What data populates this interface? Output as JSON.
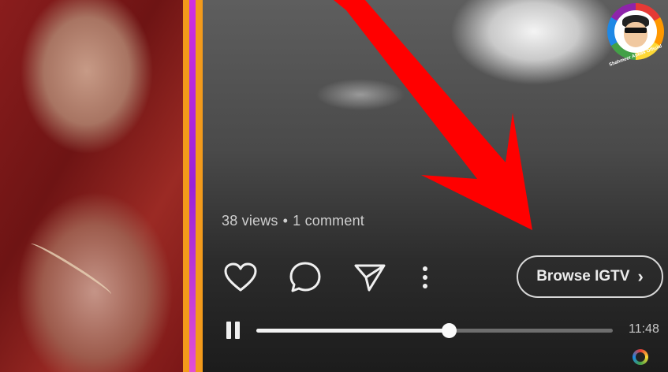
{
  "video": {
    "stats": {
      "views": "38 views",
      "separator": "•",
      "comments": "1 comment"
    },
    "actions": [
      {
        "name": "like",
        "icon": "heart-icon"
      },
      {
        "name": "comment",
        "icon": "comment-bubble-icon"
      },
      {
        "name": "share",
        "icon": "paper-plane-icon"
      },
      {
        "name": "more",
        "icon": "more-vertical-icon"
      }
    ],
    "browse_label": "Browse IGTV",
    "browse_chevron": "›",
    "progress": 0.54,
    "time": "11:48",
    "playback_state": "playing"
  },
  "overlay": {
    "arrow_color": "#ff0000",
    "divider_colors": [
      "#f39a1b",
      "#b02ad9",
      "#f39a1b"
    ]
  },
  "channel_logo": {
    "text": "Shahmeer Abbas Official"
  }
}
